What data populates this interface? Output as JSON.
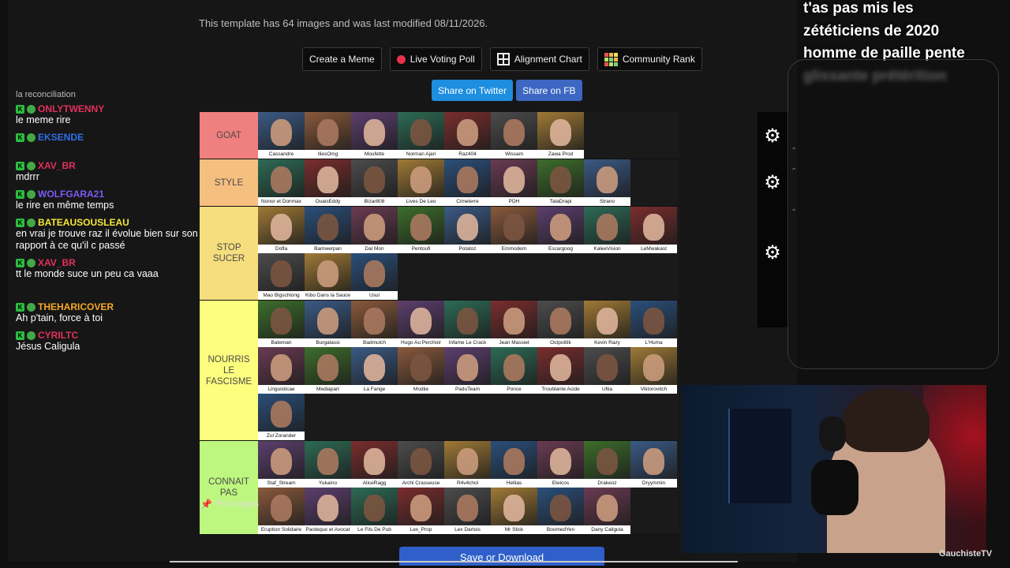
{
  "header": {
    "modified_text": "This template has 64 images and was last modified 08/11/2026."
  },
  "toolbar": {
    "create_meme": "Create a Meme",
    "live_voting": "Live Voting Poll",
    "alignment_chart": "Alignment Chart",
    "community_rank": "Community Rank"
  },
  "share": {
    "twitter": "Share on Twitter",
    "facebook": "Share on FB"
  },
  "tiers": [
    {
      "label": "GOAT",
      "color": "#f07f7f",
      "items": [
        "Cassandre",
        "IliesOmg",
        "Moufette",
        "Norman Ajari",
        "Raz404",
        "Wissam",
        "Zawa Prod"
      ]
    },
    {
      "label": "STYLE",
      "color": "#f5bf7f",
      "items": [
        "Nonor et Donmax",
        "OuaisEddy",
        "Bizar808",
        "Lives De Leo",
        "Cimeterre",
        "PDH",
        "TataDrapi",
        "Strano"
      ]
    },
    {
      "label": "STOP SUCER",
      "color": "#f6de7e",
      "items": [
        "Dofla",
        "Bamwerpan",
        "Dal Mon",
        "Pentoufi",
        "Potatoz",
        "Emmodem",
        "Escargoog",
        "KaleeVision",
        "LeMwakast",
        "Mao Bigschlong",
        "Kibo Dans la Sauce",
        "Usul"
      ]
    },
    {
      "label": "NOURRIS LE FASCISME",
      "color": "#fdfd7e",
      "items": [
        "Bateman",
        "Burgalassi",
        "Badmulch",
        "Hugo Au Perchoir",
        "Infame Le Crack",
        "Jean Massiet",
        "Ostpolitik",
        "Kevin Razy",
        "L'Huma",
        "Linguisticae",
        "Mediapart",
        "La Fange",
        "Modiie",
        "PaduTeam",
        "Ponce",
        "Troublante Acide",
        "Ultia",
        "Viktorovitch",
        "Zul Zorander"
      ]
    },
    {
      "label": "CONNAIT PAS",
      "color": "#bef77f",
      "items": [
        "Staf_Stream",
        "Yukaino",
        "AliceRagg",
        "Archi Crasseuse",
        "R4v4chol",
        "Hellias",
        "Eteicos",
        "Drakeoz",
        "Dryymmin",
        "Eruption Solidaire",
        "Pasteque et Avocat",
        "Le Fils De Pub",
        "Lex_Prop",
        "Lex Dartois",
        "Mr Stick",
        "BoomedYen",
        "Dany Caligula"
      ]
    }
  ],
  "pin": {
    "label": "Pin Images",
    "icon": "pin-icon"
  },
  "save": {
    "label": "Save or Download"
  },
  "chat_top": {
    "lines": [
      "t'as pas mis les",
      "zététiciens de 2020",
      "homme de paille pente",
      "glissante prétérition"
    ]
  },
  "chat": {
    "reply_context": "la reconciliation",
    "messages": [
      {
        "user": "ONLYTWENNY",
        "color": "#e0305a",
        "text": "le meme rire"
      },
      {
        "user": "EKSENDE",
        "color": "#2f6fe8",
        "text": ""
      },
      {
        "user": "XAV_BR",
        "color": "#e0305a",
        "text": "mdrrr"
      },
      {
        "user": "WOLFGARA21",
        "color": "#7b5bf5",
        "text": "le rire en même temps"
      },
      {
        "user": "BATEAUSOUSLEAU",
        "color": "#f5e637",
        "text": "en vrai je trouve raz il évolue bien sur son rapport à ce qu'il c passé"
      },
      {
        "user": "XAV_BR",
        "color": "#e0305a",
        "text": "tt le monde suce un peu ca vaaa"
      },
      {
        "user": "THEHARICOVER",
        "color": "#f7a825",
        "text": "Ah p'tain, force à toi"
      },
      {
        "user": "CYRILTC",
        "color": "#e0305a",
        "text": "Jésus Caligula"
      }
    ]
  },
  "webcam": {
    "label": "GauchisteTV"
  }
}
